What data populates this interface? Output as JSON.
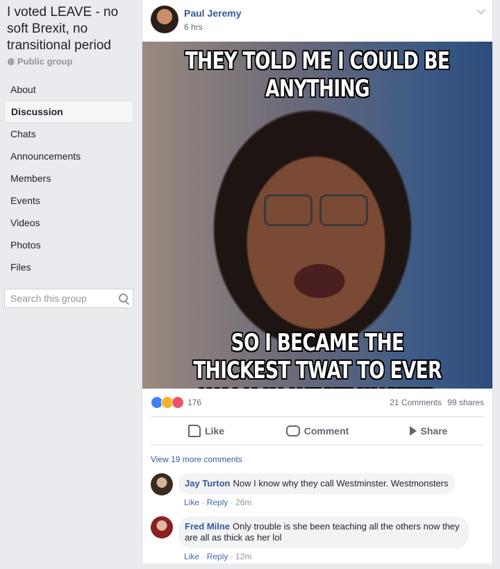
{
  "group": {
    "title": "I voted LEAVE - no soft Brexit, no transitional period",
    "type_label": "Public group"
  },
  "nav": {
    "items": [
      "About",
      "Discussion",
      "Chats",
      "Announcements",
      "Members",
      "Events",
      "Videos",
      "Photos",
      "Files"
    ],
    "active": "Discussion"
  },
  "search": {
    "placeholder": "Search this group"
  },
  "post": {
    "author": "Paul Jeremy",
    "time": "6 hrs",
    "meme_top_text": "THEY TOLD ME I COULD BE ANYTHING",
    "meme_bottom_text": "SO I BECAME THE THICKEST TWAT TO EVER WALK IN WESTMINSTER",
    "reaction_count": "176",
    "comments_count": "21 Comments",
    "shares_count": "99 shares",
    "actions": {
      "like": "Like",
      "comment": "Comment",
      "share": "Share"
    },
    "view_more": "View 19 more comments"
  },
  "comments": [
    {
      "name": "Jay Turton",
      "text": "Now I know why they call Westminster. Westmonsters",
      "like": "Like",
      "reply": "Reply",
      "time": "26m"
    },
    {
      "name": "Fred Milne",
      "text": "Only trouble is she been teaching all the others now they are all as thick as her lol",
      "like": "Like",
      "reply": "Reply",
      "time": "12m"
    }
  ],
  "colors": {
    "link": "#365899",
    "background": "#e9ebee",
    "like_reaction": "#4080ff",
    "haha_reaction": "#f7b125",
    "love_reaction": "#f25268"
  },
  "icons": [
    "globe-icon",
    "search-icon",
    "chevron-down-icon",
    "like-icon",
    "comment-icon",
    "share-icon"
  ]
}
